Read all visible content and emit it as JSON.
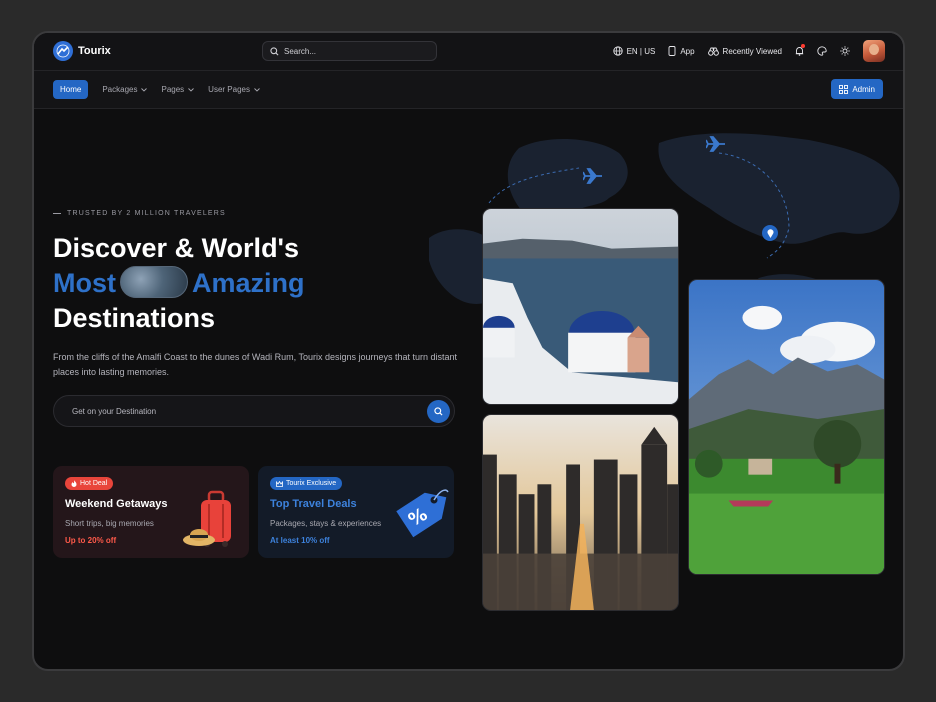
{
  "header": {
    "brand": "Tourix",
    "search_placeholder": "Search...",
    "language": "EN | US",
    "app_label": "App",
    "recently_viewed_label": "Recently Viewed"
  },
  "nav": {
    "items": [
      {
        "label": "Home",
        "active": true
      },
      {
        "label": "Packages",
        "dropdown": true
      },
      {
        "label": "Pages",
        "dropdown": true
      },
      {
        "label": "User Pages",
        "dropdown": true
      }
    ],
    "admin_label": "Admin"
  },
  "hero": {
    "eyebrow": "TRUSTED BY 2 MILLION TRAVELERS",
    "title_line1": "Discover & World's",
    "title_line2_a": "Most",
    "title_line2_b": "Amazing",
    "title_line3": "Destinations",
    "description": "From the cliffs of the Amalfi Coast to the dunes of Wadi Rum, Tourix designs journeys that turn distant places into lasting memories.",
    "destination_placeholder": "Get on your Destination"
  },
  "cards": [
    {
      "badge": "Hot Deal",
      "title": "Weekend Getaways",
      "subtitle": "Short trips, big memories",
      "offer": "Up to 20% off"
    },
    {
      "badge": "Tourix Exclusive",
      "title": "Top Travel Deals",
      "subtitle": "Packages, stays & experiences",
      "offer": "At least 10% off"
    }
  ],
  "colors": {
    "accent": "#2467c4",
    "accent_text": "#2e71c9",
    "hot": "#e9453b",
    "background": "#0e0e0f"
  },
  "icons": [
    "globe-icon",
    "phone-icon",
    "binoculars-icon",
    "bell-icon",
    "palette-icon",
    "sun-icon",
    "search-icon",
    "grid-icon",
    "plane-icon",
    "map-pin-icon",
    "chevron-down-icon"
  ]
}
